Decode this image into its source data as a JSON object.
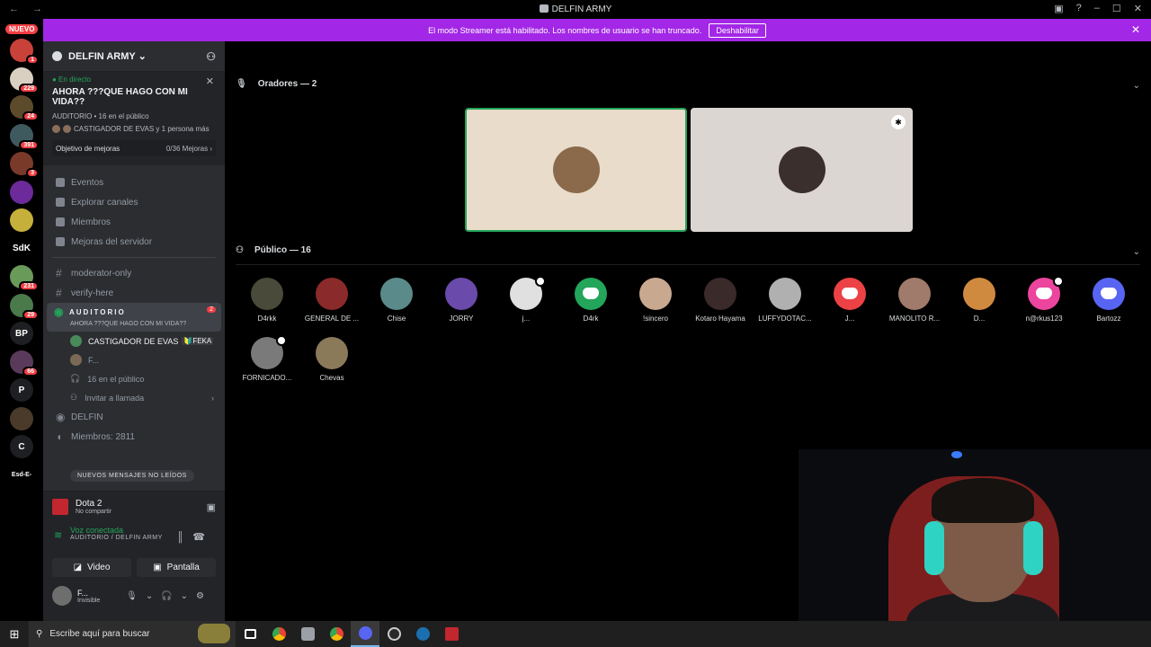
{
  "window": {
    "title": "DELFIN ARMY",
    "nav_glyphs": "← →",
    "controls": [
      "▣",
      "?",
      "–",
      "☐",
      "✕"
    ]
  },
  "banner": {
    "text": "El modo Streamer está habilitado. Los nombres de usuario se han truncado.",
    "button": "Deshabilitar",
    "close": "✕"
  },
  "servers": {
    "new_label": "NUEVO",
    "items": [
      {
        "label": "",
        "badge": "1",
        "color": "#c9423a"
      },
      {
        "label": "",
        "badge": "229",
        "color": "#d9d0c2"
      },
      {
        "label": "",
        "badge": "24",
        "color": "#5c4a2b"
      },
      {
        "label": "",
        "badge": "391",
        "color": "#3f5a5f"
      },
      {
        "label": "",
        "badge": "3",
        "color": "#7a3a2a"
      },
      {
        "label": "",
        "badge": "",
        "color": "#6c2a9a"
      },
      {
        "label": "",
        "badge": "",
        "color": "#c4b03a"
      },
      {
        "label": "SdK",
        "badge": "",
        "color": "#000000"
      },
      {
        "label": "",
        "badge": "231",
        "color": "#6a9a5a"
      },
      {
        "label": "",
        "badge": "29",
        "color": "#4a7a4a"
      },
      {
        "label": "BP",
        "badge": "",
        "color": "#1e1f22"
      },
      {
        "label": "",
        "badge": "66",
        "color": "#5a3a5a"
      },
      {
        "label": "P",
        "badge": "",
        "color": "#1e1f22"
      },
      {
        "label": "",
        "badge": "",
        "color": "#4a3a2a"
      },
      {
        "label": "C",
        "badge": "",
        "color": "#1e1f22"
      },
      {
        "label": "Esd-E-",
        "badge": "",
        "color": "#000000"
      }
    ]
  },
  "sidebar": {
    "guild_name": "DELFIN ARMY ⌄",
    "live_label": "● En directo",
    "stage_topic": "AHORA ???QUE HAGO CON MI VIDA??",
    "stage_meta": "AUDITORIO • 16 en el público",
    "stage_who": "CASTIGADOR DE EVAS y 1 persona más",
    "boost_label": "Objetivo de mejoras",
    "boost_progress": "0/36 Mejoras ›",
    "nav": [
      "Eventos",
      "Explorar canales",
      "Miembros",
      "Mejoras del servidor"
    ],
    "channels": [
      "moderator-only",
      "verify-here"
    ],
    "stage_channel": {
      "name": "AUDITORIO",
      "subtitle": "AHORA ???QUE HAGO CON MI VIDA??",
      "badge": "2"
    },
    "stage_members": [
      {
        "name": "CASTIGADOR DE EVAS",
        "tag": "🔰FEKA"
      },
      {
        "name": "F...",
        "tag": ""
      }
    ],
    "audience": "16 en el público",
    "invite": "Invitar a llamada",
    "delfin": "DELFIN",
    "members_count": "Miembros: 2811",
    "new_messages": "NUEVOS MENSAJES NO LEÍDOS",
    "activity": {
      "name": "Dota 2",
      "detail": "No compartir"
    },
    "voice": {
      "status": "Voz conectada",
      "channel": "AUDITORIO / DELFIN ARMY"
    },
    "video_btn": "Video",
    "screen_btn": "Pantalla",
    "user": {
      "name": "F...",
      "status": "Invisible"
    }
  },
  "main": {
    "speakers_header": "Oradores — 2",
    "audience_header": "Público — 16",
    "speakers": [
      {
        "color": "#e9dccb",
        "avatar": "#8a6a4a",
        "active": true
      },
      {
        "color": "#dcd6d2",
        "avatar": "#3a2f2c",
        "active": false
      }
    ],
    "audience": [
      {
        "name": "D4rkk",
        "type": "photo",
        "color": "#4a4a3a"
      },
      {
        "name": "GENERAL DE ...",
        "type": "photo",
        "color": "#8a2a2a"
      },
      {
        "name": "Chise",
        "type": "photo",
        "color": "#5a8a8a"
      },
      {
        "name": "JORRY",
        "type": "photo",
        "color": "#6a4aaa"
      },
      {
        "name": "j...",
        "type": "photo",
        "color": "#e0e0e0",
        "badge": true
      },
      {
        "name": "D4rk",
        "type": "discord",
        "color": "green"
      },
      {
        "name": "!sincero",
        "type": "photo",
        "color": "#c9a890"
      },
      {
        "name": "Kotaro Hayama",
        "type": "photo",
        "color": "#3a2a2a"
      },
      {
        "name": "LUFFYDOTAC...",
        "type": "photo",
        "color": "#b0b0b0"
      },
      {
        "name": "J...",
        "type": "discord",
        "color": "red"
      },
      {
        "name": "MANOLITO R...",
        "type": "photo",
        "color": "#a07a6a"
      },
      {
        "name": "D...",
        "type": "photo",
        "color": "#d08a40"
      },
      {
        "name": "n@rkus123",
        "type": "discord",
        "color": "pink",
        "badge": true
      },
      {
        "name": "Bartozz",
        "type": "discord",
        "color": "blue"
      },
      {
        "name": "FORNICADO...",
        "type": "photo",
        "color": "#7a7a7a",
        "badge": true
      },
      {
        "name": "Chevas",
        "type": "photo",
        "color": "#8a7a5a"
      }
    ]
  },
  "taskbar": {
    "search_placeholder": "Escribe aquí para buscar"
  }
}
